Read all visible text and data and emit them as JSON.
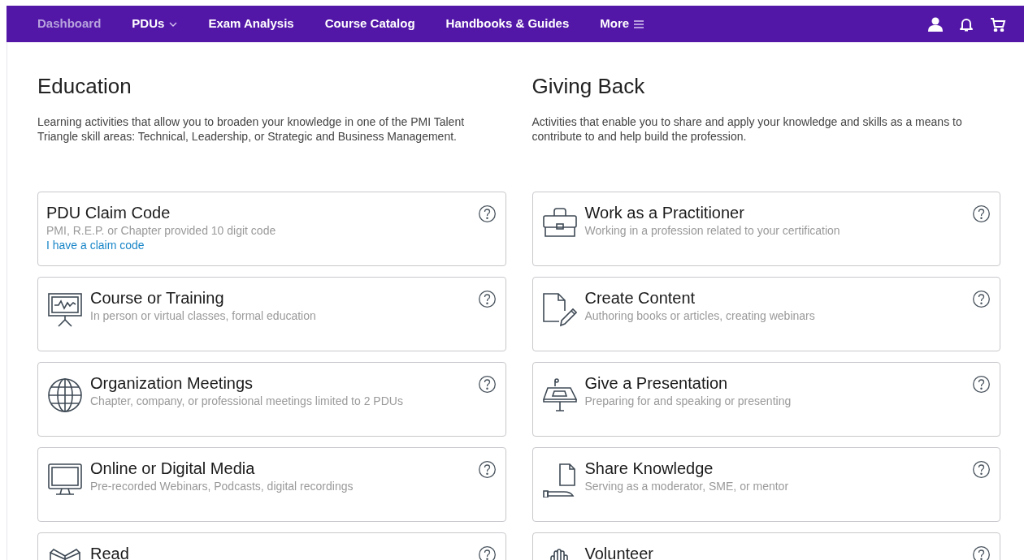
{
  "nav": {
    "items": [
      {
        "label": "Dashboard",
        "selected": true,
        "kind": "link"
      },
      {
        "label": "PDUs",
        "selected": false,
        "kind": "dropdown"
      },
      {
        "label": "Exam Analysis",
        "selected": false,
        "kind": "link"
      },
      {
        "label": "Course Catalog",
        "selected": false,
        "kind": "link"
      },
      {
        "label": "Handbooks & Guides",
        "selected": false,
        "kind": "link"
      },
      {
        "label": "More",
        "selected": false,
        "kind": "menu"
      }
    ]
  },
  "sections": [
    {
      "title": "Education",
      "description": "Learning activities that allow you to broaden your knowledge in one of the PMI Talent Triangle skill areas: Technical, Leadership, or Strategic and Business Management.",
      "cards": [
        {
          "title": "PDU Claim Code",
          "subtitle": "PMI, R.E.P. or Chapter provided 10 digit code",
          "link": "I have a claim code",
          "kind": "none"
        },
        {
          "title": "Course or Training",
          "subtitle": "In person or virtual classes, formal education",
          "kind": "easel"
        },
        {
          "title": "Organization Meetings",
          "subtitle": "Chapter, company, or professional meetings limited to 2 PDUs",
          "kind": "globe"
        },
        {
          "title": "Online or Digital Media",
          "subtitle": "Pre-recorded Webinars, Podcasts, digital recordings",
          "kind": "monitor"
        },
        {
          "title": "Read",
          "kind": "book"
        }
      ]
    },
    {
      "title": "Giving Back",
      "description": "Activities that enable you to share and apply your knowledge and skills as a means to contribute to and help build the profession.",
      "cards": [
        {
          "title": "Work as a Practitioner",
          "subtitle": "Working in a profession related to your certification",
          "kind": "briefcase"
        },
        {
          "title": "Create Content",
          "subtitle": "Authoring books or articles, creating webinars",
          "kind": "document"
        },
        {
          "title": "Give a Presentation",
          "subtitle": "Preparing for and speaking or presenting",
          "kind": "podium"
        },
        {
          "title": "Share Knowledge",
          "subtitle": "Serving as a moderator, SME, or mentor",
          "kind": "handout"
        },
        {
          "title": "Volunteer",
          "kind": "hand"
        }
      ]
    }
  ]
}
